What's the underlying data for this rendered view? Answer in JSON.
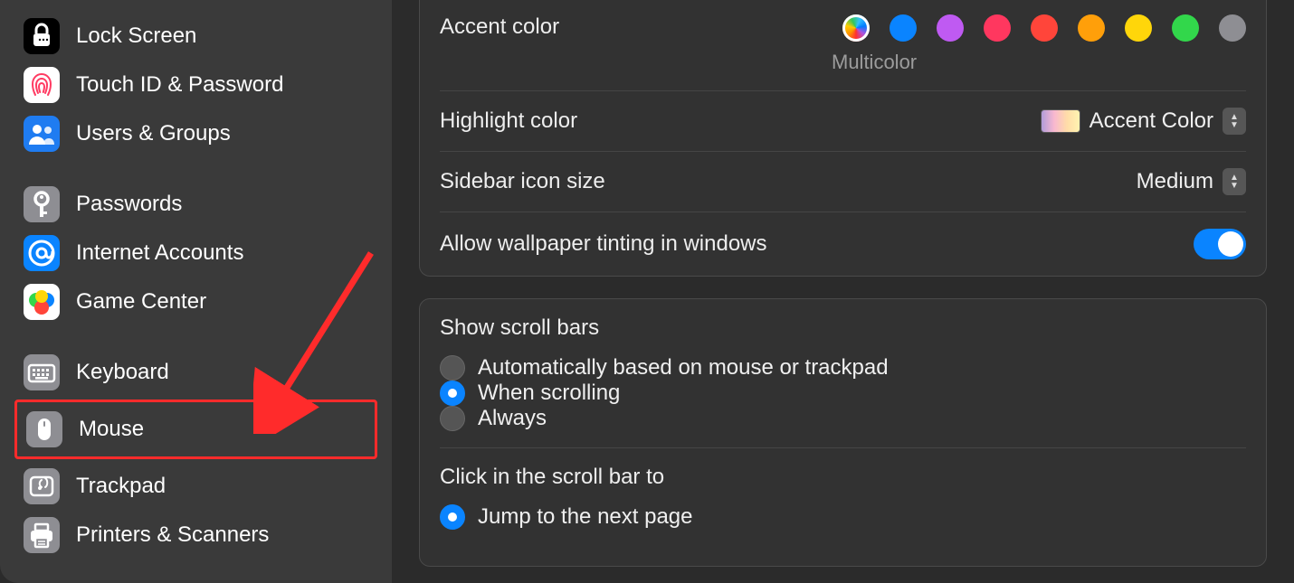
{
  "sidebar": {
    "items": [
      {
        "label": "Lock Screen",
        "icon": "lock",
        "iconBg": "#000000",
        "iconFg": "#ffffff"
      },
      {
        "label": "Touch ID & Password",
        "icon": "fingerprint",
        "iconBg": "#ffffff",
        "iconFg": "#ff3b62"
      },
      {
        "label": "Users & Groups",
        "icon": "users",
        "iconBg": "#1f7cf1",
        "iconFg": "#ffffff"
      },
      {
        "label": "Passwords",
        "icon": "key",
        "iconBg": "#8e8e93",
        "iconFg": "#ffffff"
      },
      {
        "label": "Internet Accounts",
        "icon": "at",
        "iconBg": "#0a84ff",
        "iconFg": "#ffffff"
      },
      {
        "label": "Game Center",
        "icon": "gamecenter",
        "iconBg": "#ffffff",
        "iconFg": ""
      },
      {
        "label": "Keyboard",
        "icon": "keyboard",
        "iconBg": "#8e8e93",
        "iconFg": "#ffffff"
      },
      {
        "label": "Mouse",
        "icon": "mouse",
        "iconBg": "#8e8e93",
        "iconFg": "#ffffff"
      },
      {
        "label": "Trackpad",
        "icon": "trackpad",
        "iconBg": "#8e8e93",
        "iconFg": "#ffffff"
      },
      {
        "label": "Printers & Scanners",
        "icon": "printer",
        "iconBg": "#8e8e93",
        "iconFg": "#ffffff"
      }
    ]
  },
  "annotation": {
    "highlighted_item": "Mouse"
  },
  "appearance": {
    "accent_label": "Accent color",
    "accent_selected_label": "Multicolor",
    "accent_colors": [
      "multicolor",
      "#0a84ff",
      "#bf5af2",
      "#ff375f",
      "#ff453a",
      "#ff9f0a",
      "#ffd60a",
      "#32d74b",
      "#8e8e93"
    ],
    "highlight_label": "Highlight color",
    "highlight_value": "Accent Color",
    "sidebar_size_label": "Sidebar icon size",
    "sidebar_size_value": "Medium",
    "tinting_label": "Allow wallpaper tinting in windows",
    "tinting_on": true,
    "scroll_title": "Show scroll bars",
    "scroll_options": [
      "Automatically based on mouse or trackpad",
      "When scrolling",
      "Always"
    ],
    "scroll_selected": "When scrolling",
    "click_title": "Click in the scroll bar to",
    "click_options": [
      "Jump to the next page"
    ],
    "click_selected": "Jump to the next page"
  }
}
